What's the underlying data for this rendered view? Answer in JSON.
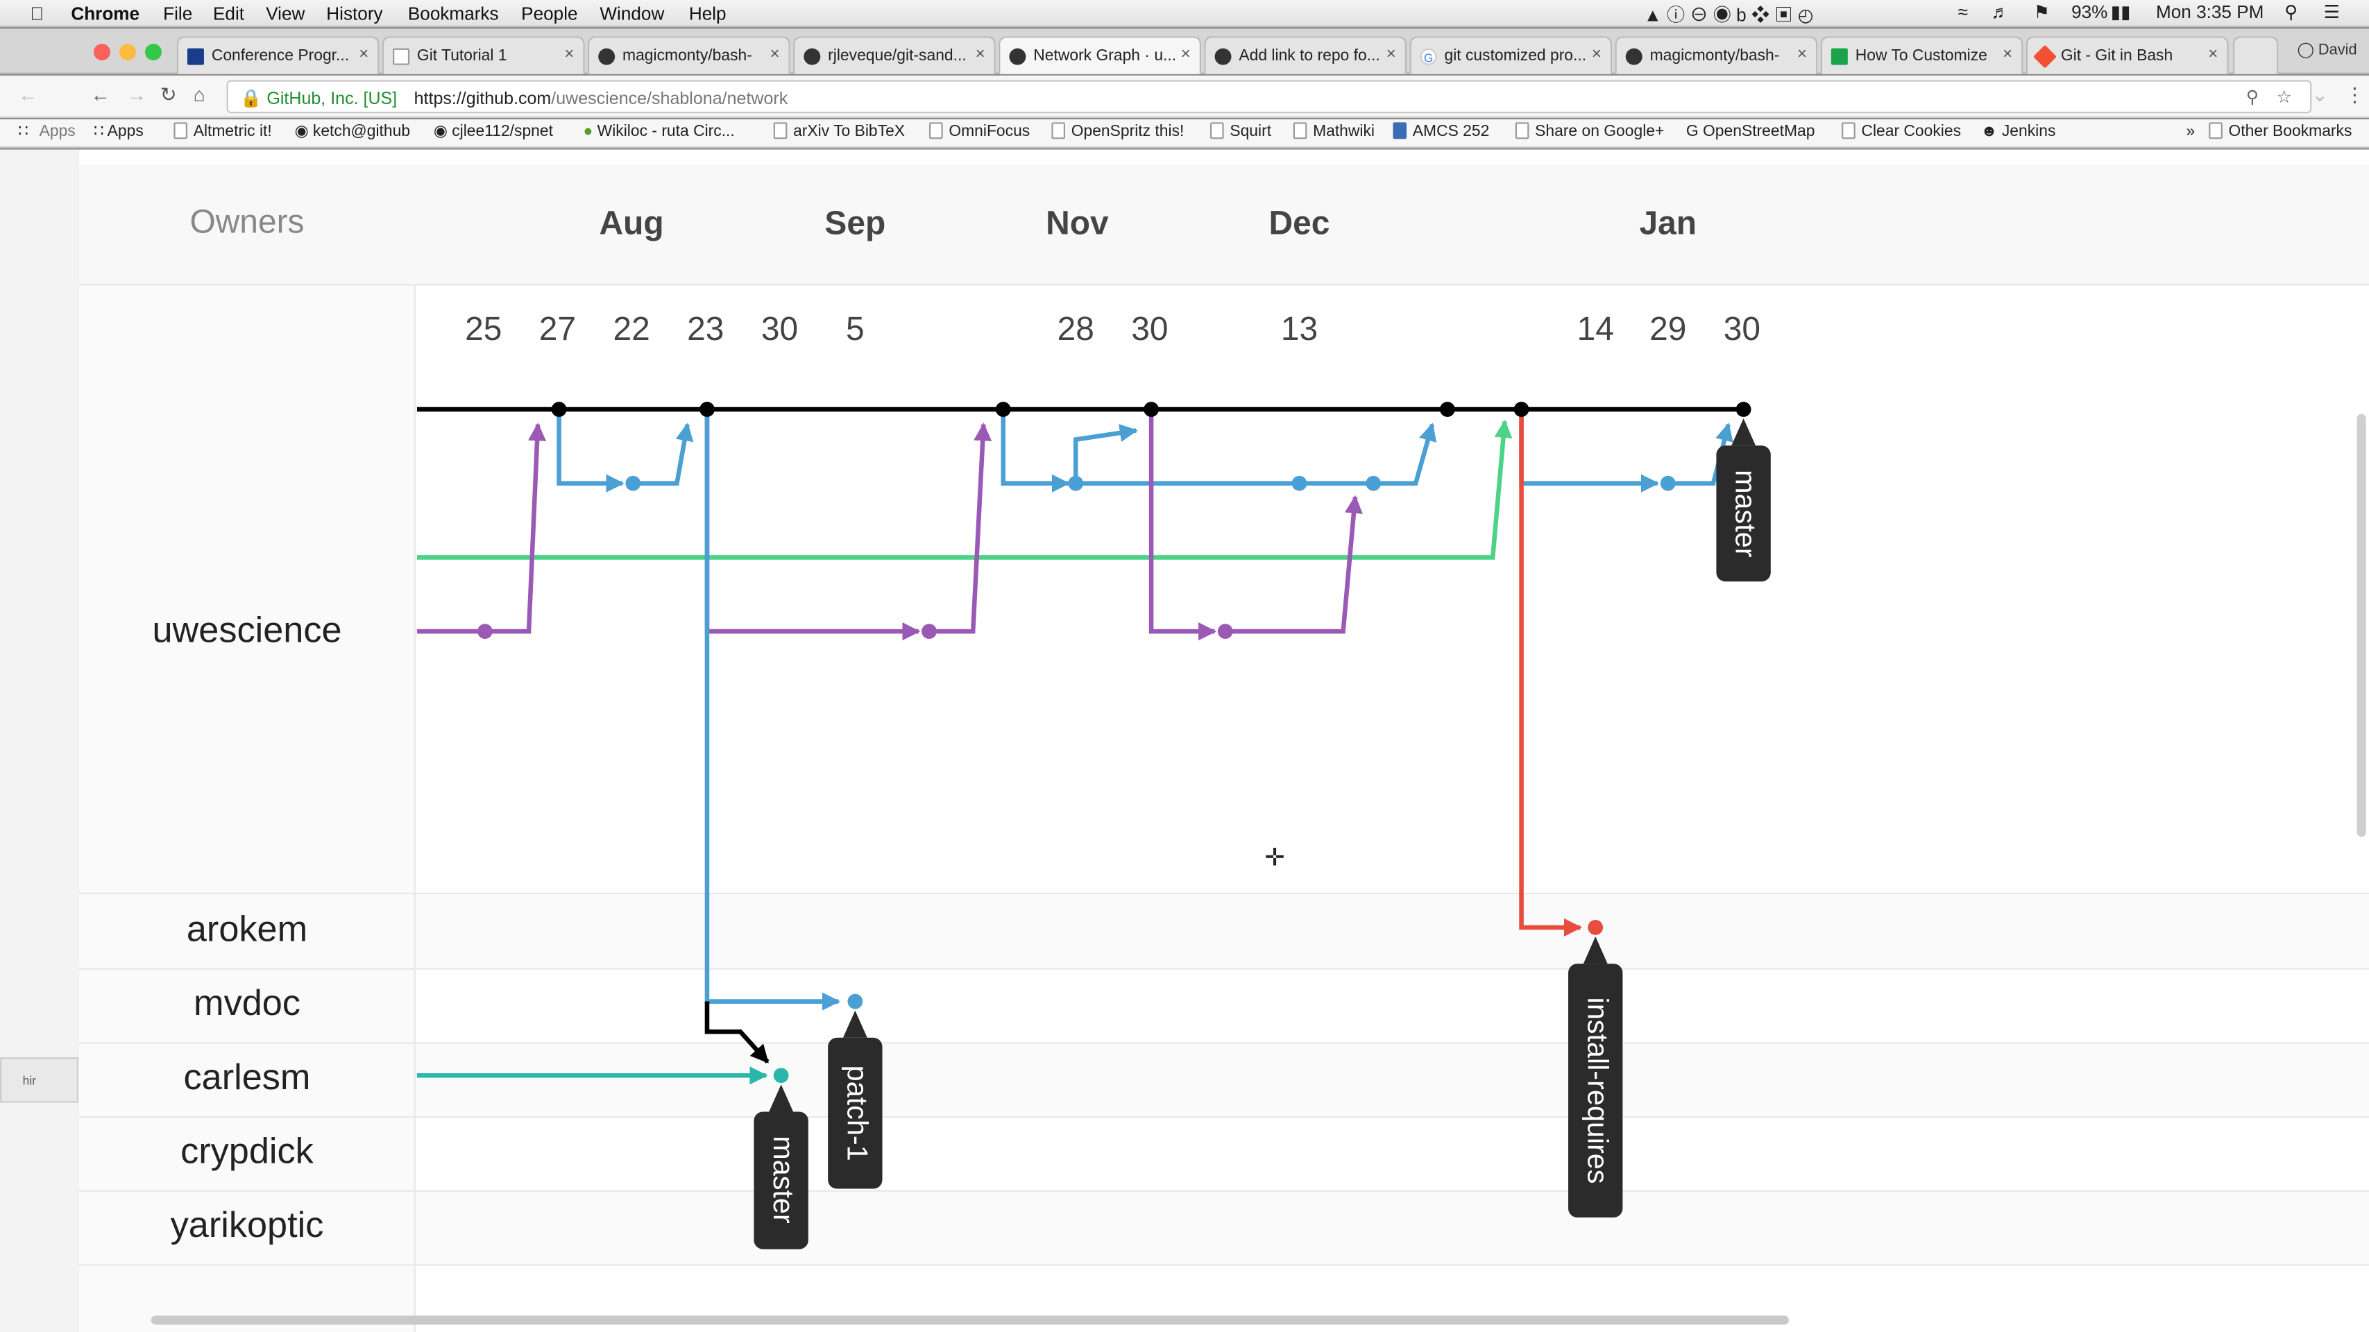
{
  "menubar": {
    "app": "Chrome",
    "items": [
      "File",
      "Edit",
      "View",
      "History",
      "Bookmarks",
      "People",
      "Window",
      "Help"
    ],
    "battery": "93%",
    "clock": "Mon 3:35 PM"
  },
  "tabs": [
    {
      "title": "Conference Progr..."
    },
    {
      "title": "Git Tutorial 1"
    },
    {
      "title": "magicmonty/bash-"
    },
    {
      "title": "rjleveque/git-sand..."
    },
    {
      "title": "Network Graph · u..."
    },
    {
      "title": "Add link to repo fo..."
    },
    {
      "title": "git customized pro..."
    },
    {
      "title": "magicmonty/bash-"
    },
    {
      "title": "How To Customize"
    },
    {
      "title": "Git - Git in Bash"
    }
  ],
  "profile_name": "David",
  "address": {
    "security_label": "GitHub, Inc. [US]",
    "scheme_host": "https://github.com",
    "path": "/uwescience/shablona/network"
  },
  "bookmarks": [
    "Apps",
    "Altmetric it!",
    "ketch@github",
    "cjlee112/spnet",
    "Wikiloc - ruta Circ...",
    "arXiv To BibTeX",
    "OmniFocus",
    "OpenSpritz this!",
    "Squirt",
    "Mathwiki",
    "AMCS 252",
    "Share on Google+",
    "OpenStreetMap",
    "Clear Cookies",
    "Jenkins"
  ],
  "other_bookmarks": "Other Bookmarks",
  "network": {
    "owners_label": "Owners",
    "months": [
      "Aug",
      "Sep",
      "Nov",
      "Dec",
      "Jan"
    ],
    "days": [
      "25",
      "27",
      "22",
      "23",
      "30",
      "5",
      "28",
      "30",
      "13",
      "14",
      "29",
      "30"
    ],
    "owners": [
      "uwescience",
      "arokem",
      "mvdoc",
      "carlesm",
      "crypdick",
      "yarikoptic"
    ],
    "branch_labels": [
      "master",
      "patch-1",
      "master",
      "install-requires"
    ],
    "colors": {
      "master": "#000000",
      "blue": "#4a9fd4",
      "purple": "#9b59b6",
      "green": "#4cd387",
      "teal": "#2ab7a9",
      "red": "#e74c3c",
      "label_bg": "#2b2b2b"
    }
  }
}
